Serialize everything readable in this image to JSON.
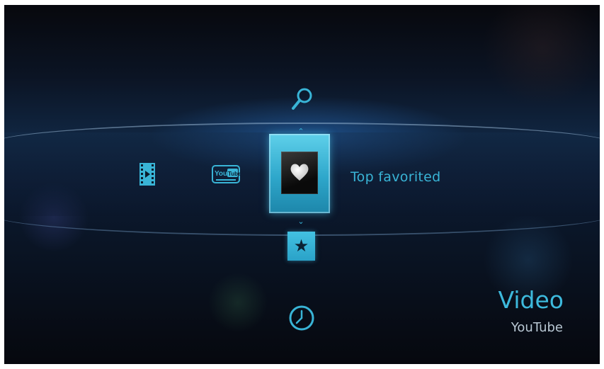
{
  "colors": {
    "accent": "#39b4d6",
    "background": "#0b1424",
    "subtitle": "#b9c8d4"
  },
  "menu": {
    "items": [
      {
        "icon": "search-icon"
      },
      {
        "icon": "film-icon"
      },
      {
        "icon": "youtube-icon",
        "logo_text": "You Tube"
      },
      {
        "icon": "heart-icon",
        "selected": true
      },
      {
        "icon": "star-icon",
        "glyph": "★"
      },
      {
        "icon": "clock-icon"
      }
    ],
    "selected_label": "Top favorited"
  },
  "header": {
    "title": "Video",
    "subtitle": "YouTube"
  }
}
